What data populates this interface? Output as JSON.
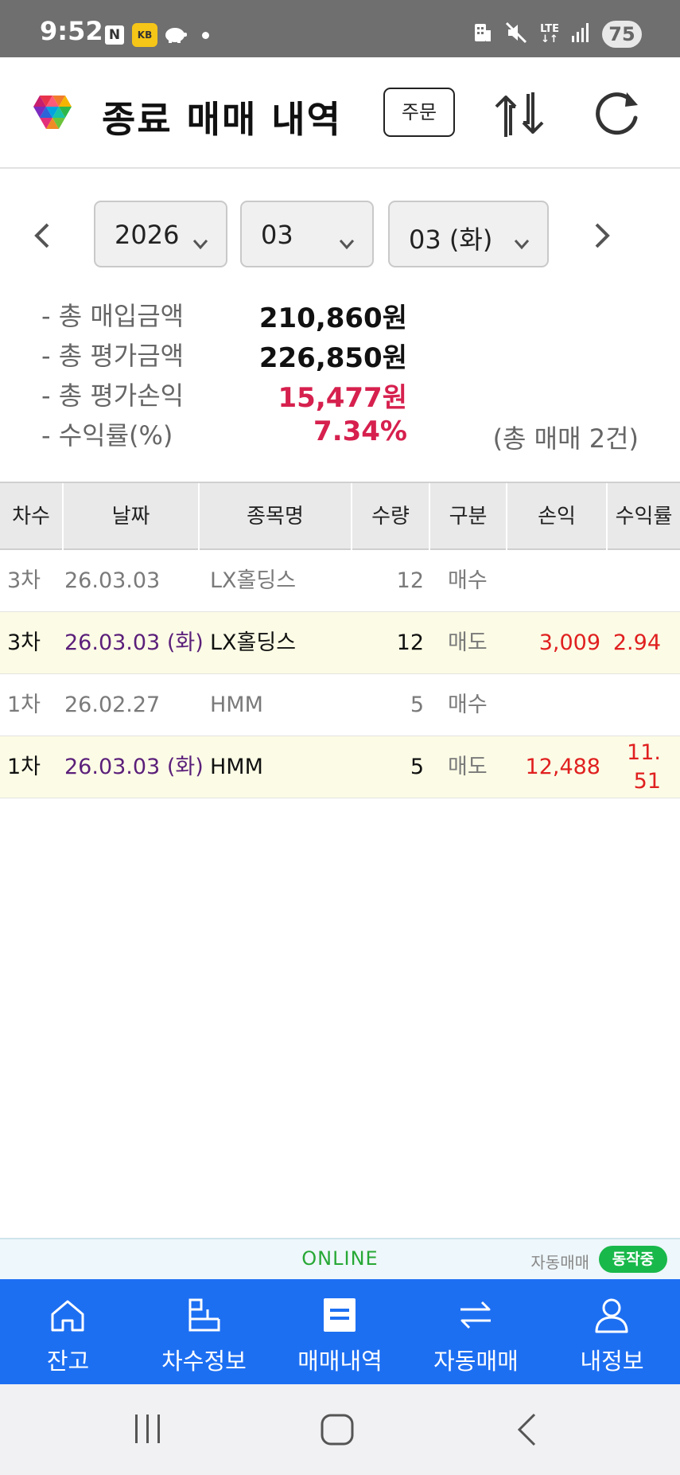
{
  "status_bar": {
    "time": "9:52",
    "notif_n": "N",
    "notif_kb": "KB",
    "network": "LTE",
    "battery": "75"
  },
  "header": {
    "title": "종료 매매 내역",
    "order_label": "주문"
  },
  "date_selector": {
    "year": "2026",
    "month": "03",
    "day": "03 (화)"
  },
  "summary": {
    "items": [
      {
        "label": "- 총 매입금액",
        "value": "210,860원"
      },
      {
        "label": "- 총 평가금액",
        "value": "226,850원"
      },
      {
        "label": "- 총 평가손익",
        "value": "15,477원"
      },
      {
        "label": "- 수익률(%)",
        "value": "7.34%"
      }
    ],
    "trade_count": "(총 매매 2건)"
  },
  "table": {
    "headers": [
      "차수",
      "날짜",
      "종목명",
      "수량",
      "구분",
      "손익",
      "수익률"
    ],
    "rows": [
      {
        "round": "3차",
        "date": "26.03.03",
        "name": "LX홀딩스",
        "qty": "12",
        "type": "매수",
        "pnl": "",
        "rate": ""
      },
      {
        "round": "3차",
        "date": "26.03.03 (화)",
        "name": "LX홀딩스",
        "qty": "12",
        "type": "매도",
        "pnl": "3,009",
        "rate": "2.94"
      },
      {
        "round": "1차",
        "date": "26.02.27",
        "name": "HMM",
        "qty": "5",
        "type": "매수",
        "pnl": "",
        "rate": ""
      },
      {
        "round": "1차",
        "date": "26.03.03 (화)",
        "name": "HMM",
        "qty": "5",
        "type": "매도",
        "pnl": "12,488",
        "rate": "11.51"
      }
    ]
  },
  "online_bar": {
    "status": "ONLINE",
    "auto_label": "자동매매",
    "auto_status": "동작중"
  },
  "tabs": [
    {
      "label": "잔고",
      "icon": "home-icon"
    },
    {
      "label": "차수정보",
      "icon": "steps-icon"
    },
    {
      "label": "매매내역",
      "icon": "list-icon"
    },
    {
      "label": "자동매매",
      "icon": "swap-icon"
    },
    {
      "label": "내정보",
      "icon": "user-icon"
    }
  ],
  "colors": {
    "accent_blue": "#1d6ff2",
    "profit_red": "#d6204e",
    "online_green": "#27a836",
    "sell_row_bg": "#fcfce6"
  }
}
